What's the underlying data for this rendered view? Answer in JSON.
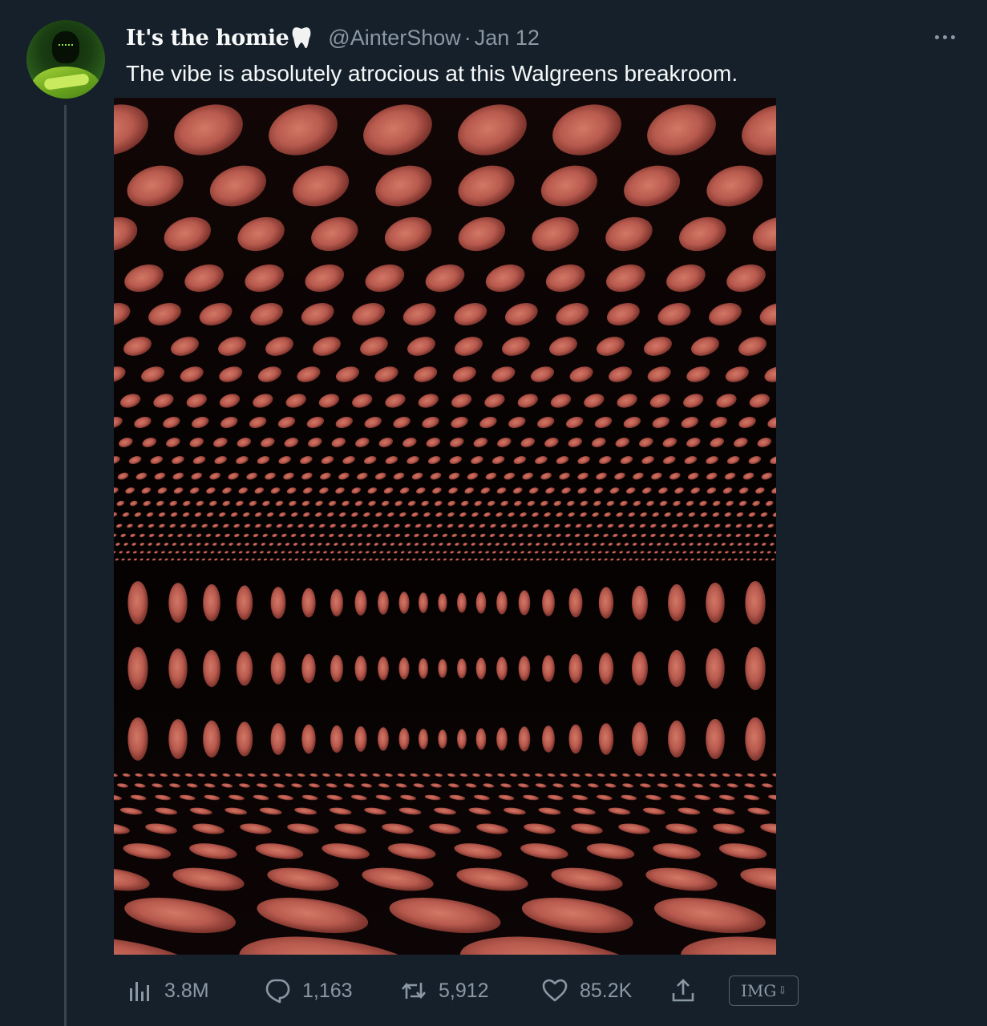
{
  "author": {
    "display_name": "It's the homie",
    "name_emoji_icon": "tooth-icon",
    "handle": "@AinterShow",
    "separator": "·",
    "date": "Jan 12"
  },
  "tweet": {
    "text": "The vibe is absolutely atrocious at this Walgreens breakroom.",
    "media_description_icon": "image"
  },
  "actions": {
    "views": {
      "icon": "analytics-icon",
      "count": "3.8M"
    },
    "replies": {
      "icon": "reply-icon",
      "count": "1,163"
    },
    "retweets": {
      "icon": "retweet-icon",
      "count": "5,912"
    },
    "likes": {
      "icon": "heart-icon",
      "count": "85.2K"
    },
    "share": {
      "icon": "share-icon"
    },
    "badge": {
      "label": "IMG",
      "arrow": "⇩"
    }
  },
  "colors": {
    "background": "#15202b",
    "text_primary": "#f7f9f9",
    "text_secondary": "#8b98a5",
    "thread_line": "#38444d",
    "media_face": "#b85a4e"
  }
}
